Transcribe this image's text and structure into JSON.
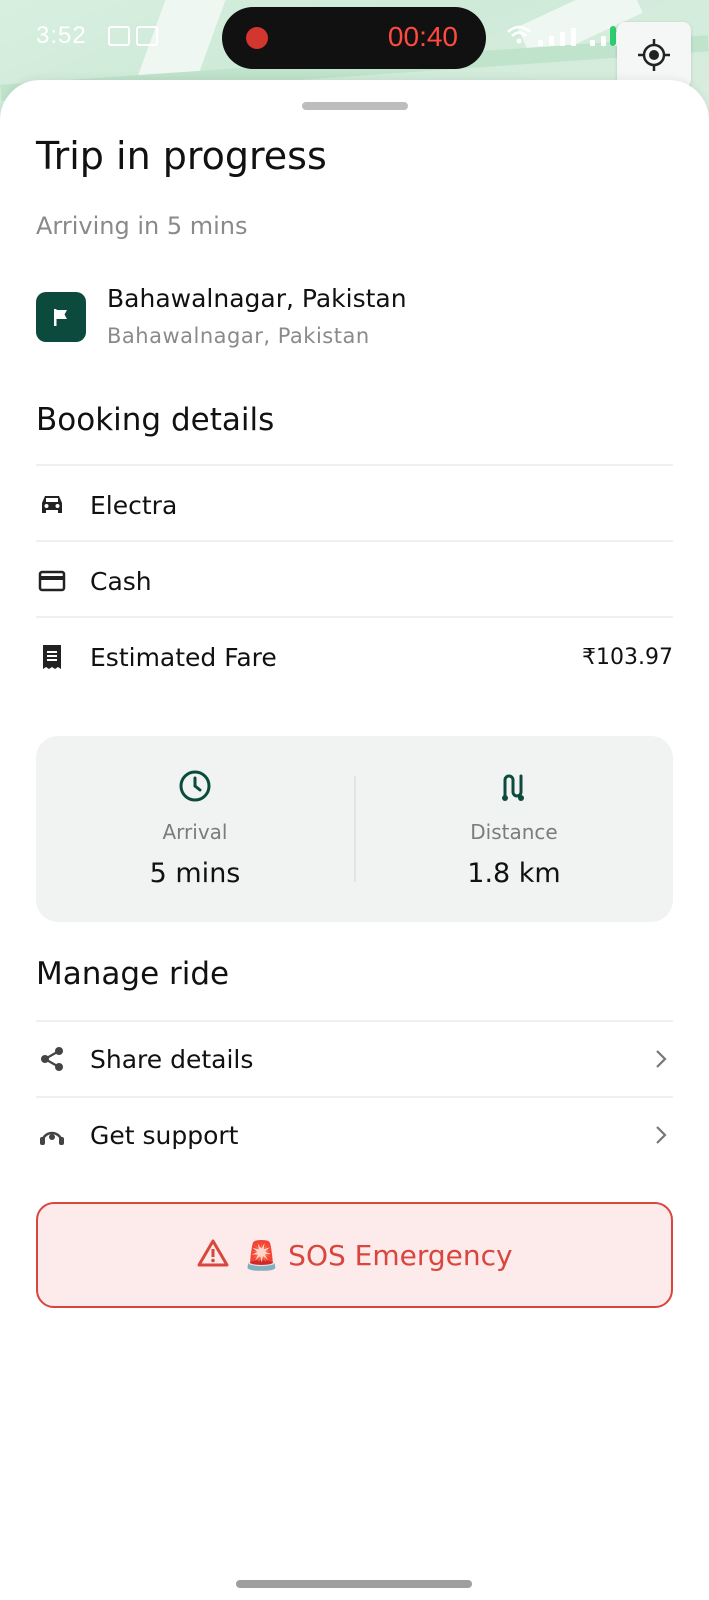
{
  "status_bar": {
    "time": "3:52",
    "recording_time": "00:40"
  },
  "sheet": {
    "title": "Trip in progress",
    "subtitle": "Arriving in 5 mins",
    "destination": {
      "name": "Bahawalnagar, Pakistan",
      "address": "Bahawalnagar, Pakistan",
      "icon": "flag-icon"
    }
  },
  "booking": {
    "title": "Booking details",
    "rows": [
      {
        "icon": "car-icon",
        "label": "Electra",
        "value": ""
      },
      {
        "icon": "credit-card-icon",
        "label": "Cash",
        "value": ""
      },
      {
        "icon": "receipt-icon",
        "label": "Estimated Fare",
        "value": "₹103.97"
      }
    ]
  },
  "stats": {
    "arrival": {
      "icon": "clock-icon",
      "label": "Arrival",
      "value": "5 mins"
    },
    "distance": {
      "icon": "route-icon",
      "label": "Distance",
      "value": "1.8 km"
    }
  },
  "manage": {
    "title": "Manage ride",
    "items": [
      {
        "icon": "share-icon",
        "label": "Share details"
      },
      {
        "icon": "support-icon",
        "label": "Get support"
      }
    ]
  },
  "sos": {
    "label": "🚨 SOS Emergency",
    "icon": "warning-icon"
  },
  "colors": {
    "brand": "#0b4a3c",
    "danger": "#d9463e",
    "danger_bg": "#fdeaea",
    "card_bg": "#f1f3f2"
  }
}
